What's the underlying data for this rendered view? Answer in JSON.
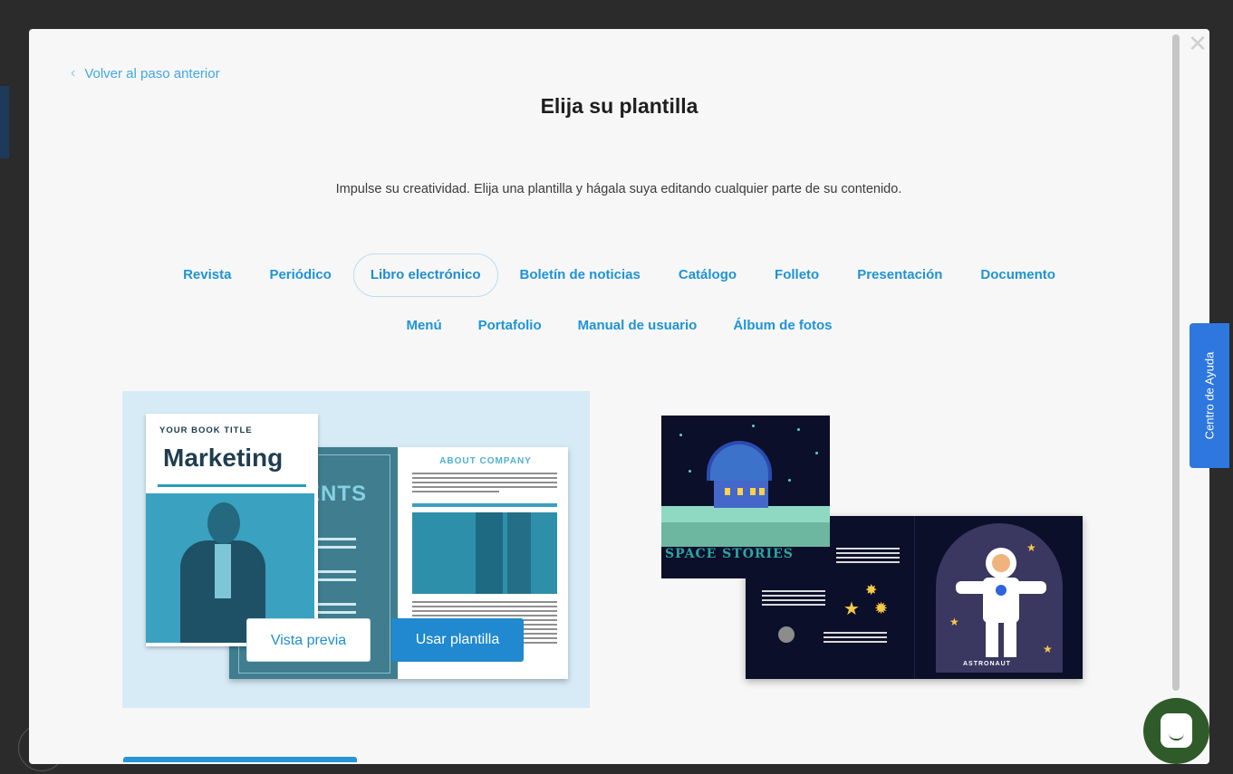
{
  "modal": {
    "back_link": "Volver al paso anterior",
    "title": "Elija su plantilla",
    "subtitle": "Impulse su creatividad. Elija una plantilla y hágala suya editando cualquier parte de su contenido."
  },
  "categories_row1": [
    "Revista",
    "Periódico",
    "Libro electrónico",
    "Boletín de noticias",
    "Catálogo",
    "Folleto",
    "Presentación",
    "Documento"
  ],
  "categories_row2": [
    "Menú",
    "Portafolio",
    "Manual de usuario",
    "Álbum de fotos"
  ],
  "active_category": "Libro electrónico",
  "template1": {
    "book_title": "YOUR BOOK TITLE",
    "heading": "Marketing",
    "left_page_text": "ENTS",
    "right_page_title": "ABOUT COMPANY",
    "preview_button": "Vista previa",
    "use_button": "Usar plantilla"
  },
  "template2": {
    "title": "SPACE STORIES",
    "astronaut_label": "ASTRONAUT"
  },
  "help_tab": "Centro de Ayuda",
  "colors": {
    "accent": "#1f93d6",
    "help_tab": "#2d77de",
    "chat": "#2f5b2a"
  }
}
